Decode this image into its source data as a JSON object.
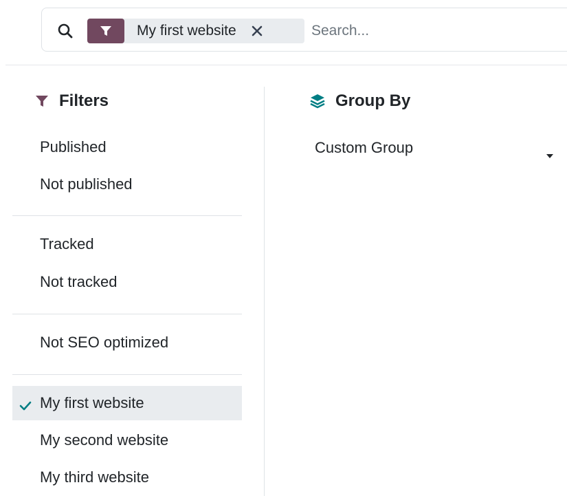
{
  "search": {
    "facet_label": "My first website",
    "placeholder": "Search...",
    "value": ""
  },
  "filters": {
    "title": "Filters",
    "items": [
      {
        "label": "Published",
        "selected": false
      },
      {
        "label": "Not published",
        "selected": false
      },
      {
        "label": "Tracked",
        "selected": false
      },
      {
        "label": "Not tracked",
        "selected": false
      },
      {
        "label": "Not SEO optimized",
        "selected": false
      },
      {
        "label": "My first website",
        "selected": true
      },
      {
        "label": "My second website",
        "selected": false
      },
      {
        "label": "My third website",
        "selected": false
      }
    ]
  },
  "group_by": {
    "title": "Group By",
    "custom_group_label": "Custom Group"
  },
  "colors": {
    "accent": "#71485f",
    "groupby_icon": "#017e84",
    "check": "#017e84",
    "selected_bg": "#e9ecef"
  },
  "icons": {
    "search": "search-icon",
    "filter": "filter-icon",
    "remove": "close-icon",
    "layers": "layers-icon",
    "check": "check-icon",
    "caret": "caret-down-icon"
  }
}
